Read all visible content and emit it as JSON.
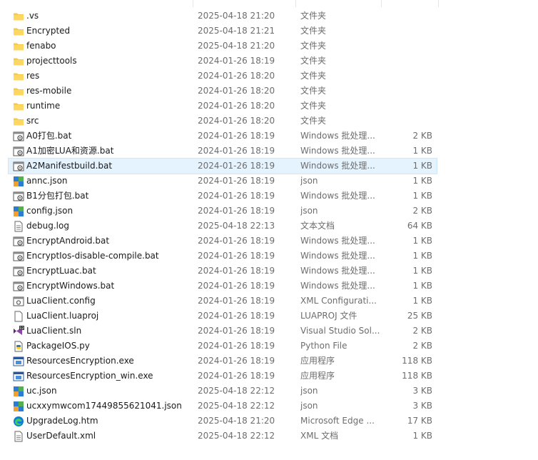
{
  "colors": {
    "folder": "#f7c948",
    "selection": "#e5f3ff",
    "secondary_text": "#6d6d6d"
  },
  "files": [
    {
      "name": ".vs",
      "date": "2025-04-18 21:20",
      "type": "文件夹",
      "size": "",
      "icon": "folder-icon"
    },
    {
      "name": "Encrypted",
      "date": "2025-04-18 21:21",
      "type": "文件夹",
      "size": "",
      "icon": "folder-icon"
    },
    {
      "name": "fenabo",
      "date": "2025-04-18 21:20",
      "type": "文件夹",
      "size": "",
      "icon": "folder-icon"
    },
    {
      "name": "projecttools",
      "date": "2024-01-26 18:19",
      "type": "文件夹",
      "size": "",
      "icon": "folder-icon"
    },
    {
      "name": "res",
      "date": "2024-01-26 18:20",
      "type": "文件夹",
      "size": "",
      "icon": "folder-icon"
    },
    {
      "name": "res-mobile",
      "date": "2024-01-26 18:20",
      "type": "文件夹",
      "size": "",
      "icon": "folder-icon"
    },
    {
      "name": "runtime",
      "date": "2024-01-26 18:20",
      "type": "文件夹",
      "size": "",
      "icon": "folder-icon"
    },
    {
      "name": "src",
      "date": "2024-01-26 18:20",
      "type": "文件夹",
      "size": "",
      "icon": "folder-icon"
    },
    {
      "name": "A0打包.bat",
      "date": "2024-01-26 18:19",
      "type": "Windows 批处理...",
      "size": "2 KB",
      "icon": "batch-icon"
    },
    {
      "name": "A1加密LUA和资源.bat",
      "date": "2024-01-26 18:19",
      "type": "Windows 批处理...",
      "size": "1 KB",
      "icon": "batch-icon"
    },
    {
      "name": "A2Manifestbuild.bat",
      "date": "2024-01-26 18:19",
      "type": "Windows 批处理...",
      "size": "1 KB",
      "icon": "batch-icon",
      "selected": true
    },
    {
      "name": "annc.json",
      "date": "2024-01-26 18:19",
      "type": "json",
      "size": "1 KB",
      "icon": "json-icon"
    },
    {
      "name": "B1分包打包.bat",
      "date": "2024-01-26 18:19",
      "type": "Windows 批处理...",
      "size": "1 KB",
      "icon": "batch-icon"
    },
    {
      "name": "config.json",
      "date": "2024-01-26 18:19",
      "type": "json",
      "size": "2 KB",
      "icon": "json-icon"
    },
    {
      "name": "debug.log",
      "date": "2025-04-18 22:13",
      "type": "文本文档",
      "size": "64 KB",
      "icon": "text-file-icon"
    },
    {
      "name": "EncryptAndroid.bat",
      "date": "2024-01-26 18:19",
      "type": "Windows 批处理...",
      "size": "1 KB",
      "icon": "batch-icon"
    },
    {
      "name": "EncryptIos-disable-compile.bat",
      "date": "2024-01-26 18:19",
      "type": "Windows 批处理...",
      "size": "1 KB",
      "icon": "batch-icon"
    },
    {
      "name": "EncryptLuac.bat",
      "date": "2024-01-26 18:19",
      "type": "Windows 批处理...",
      "size": "1 KB",
      "icon": "batch-icon"
    },
    {
      "name": "EncryptWindows.bat",
      "date": "2024-01-26 18:19",
      "type": "Windows 批处理...",
      "size": "1 KB",
      "icon": "batch-icon"
    },
    {
      "name": "LuaClient.config",
      "date": "2024-01-26 18:19",
      "type": "XML Configurati...",
      "size": "1 KB",
      "icon": "config-file-icon"
    },
    {
      "name": "LuaClient.luaproj",
      "date": "2024-01-26 18:19",
      "type": "LUAPROJ 文件",
      "size": "25 KB",
      "icon": "blank-file-icon"
    },
    {
      "name": "LuaClient.sln",
      "date": "2024-01-26 18:19",
      "type": "Visual Studio Sol...",
      "size": "2 KB",
      "icon": "visual-studio-solution-icon"
    },
    {
      "name": "PackageIOS.py",
      "date": "2024-01-26 18:19",
      "type": "Python File",
      "size": "2 KB",
      "icon": "python-file-icon"
    },
    {
      "name": "ResourcesEncryption.exe",
      "date": "2024-01-26 18:19",
      "type": "应用程序",
      "size": "118 KB",
      "icon": "exe-icon"
    },
    {
      "name": "ResourcesEncryption_win.exe",
      "date": "2024-01-26 18:19",
      "type": "应用程序",
      "size": "118 KB",
      "icon": "exe-icon"
    },
    {
      "name": "uc.json",
      "date": "2025-04-18 22:12",
      "type": "json",
      "size": "3 KB",
      "icon": "json-icon"
    },
    {
      "name": "ucxxymwcom17449855621041.json",
      "date": "2025-04-18 22:12",
      "type": "json",
      "size": "3 KB",
      "icon": "json-icon"
    },
    {
      "name": "UpgradeLog.htm",
      "date": "2025-04-18 21:20",
      "type": "Microsoft Edge ...",
      "size": "17 KB",
      "icon": "edge-icon"
    },
    {
      "name": "UserDefault.xml",
      "date": "2025-04-18 22:12",
      "type": "XML 文档",
      "size": "1 KB",
      "icon": "text-file-icon"
    }
  ]
}
